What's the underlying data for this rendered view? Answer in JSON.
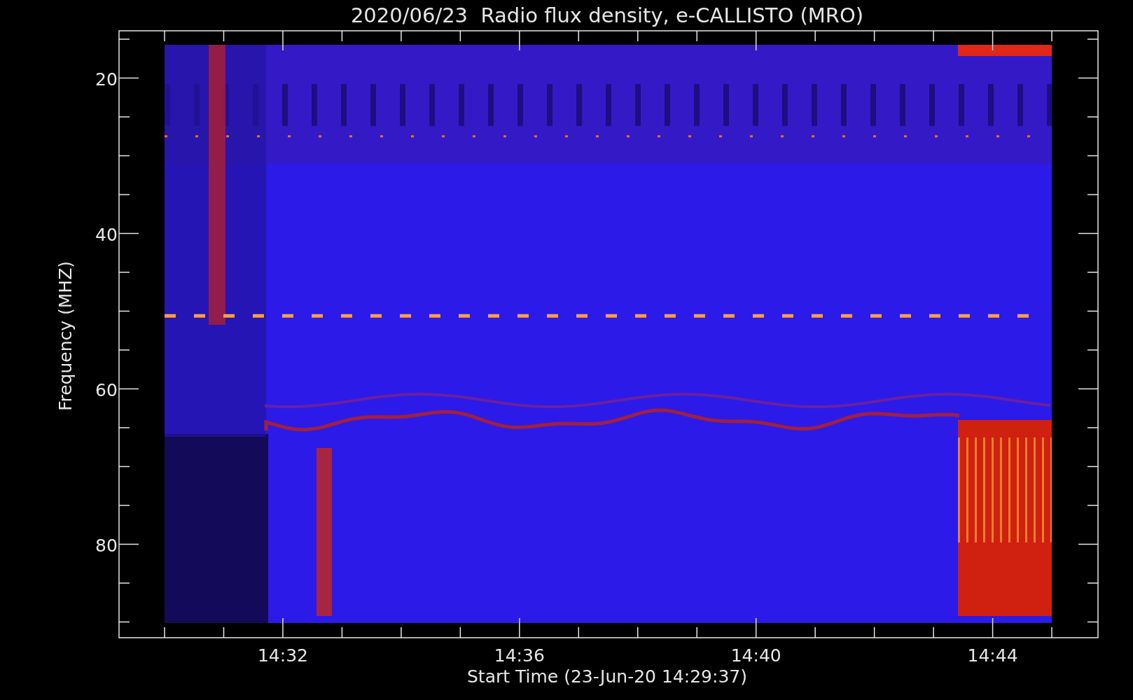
{
  "title": "2020/06/23  Radio flux density, e-CALLISTO (MRO)",
  "y_axis": {
    "label": "Frequency (MHZ)",
    "ticks": [
      {
        "label": "20"
      },
      {
        "label": "40"
      },
      {
        "label": "60"
      },
      {
        "label": "80"
      }
    ]
  },
  "x_axis": {
    "label": "Start Time (23-Jun-20 14:29:37)",
    "ticks": [
      {
        "label": "14:32"
      },
      {
        "label": "14:36"
      },
      {
        "label": "14:40"
      },
      {
        "label": "14:44"
      }
    ]
  }
}
